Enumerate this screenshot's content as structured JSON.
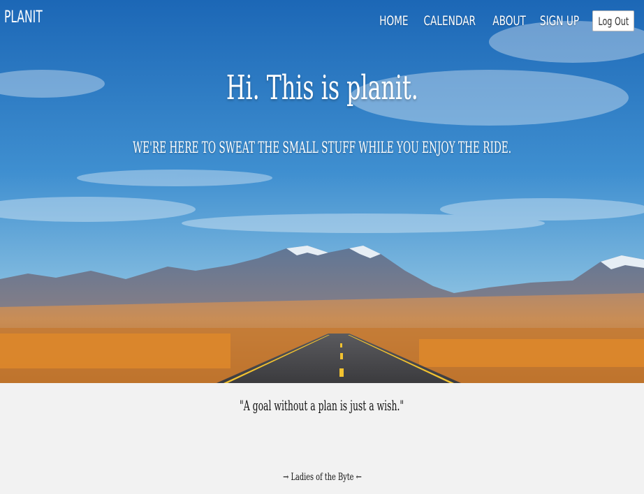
{
  "brand": {
    "name": "PLANIT"
  },
  "nav": {
    "items": [
      {
        "label": "HOME"
      },
      {
        "label": "CALENDAR"
      },
      {
        "label": "ABOUT"
      },
      {
        "label": "SIGN UP"
      }
    ],
    "logout_label": "Log Out"
  },
  "hero": {
    "headline": "Hi. This is planit.",
    "tagline": "we're here to sweat the small stuff while you enjoy the ride.",
    "image": "desert-road-mountains"
  },
  "quote": {
    "text": "\"A goal without a plan is just a wish.\""
  },
  "footer": {
    "credit": "→ Ladies of the Byte ←"
  },
  "colors": {
    "sky_top": "#1f6fbe",
    "sky_bottom": "#7fb8dc",
    "desert": "#c9874a",
    "road": "#4a4a4a",
    "road_line": "#f2c230",
    "background": "#f2f2f2"
  }
}
